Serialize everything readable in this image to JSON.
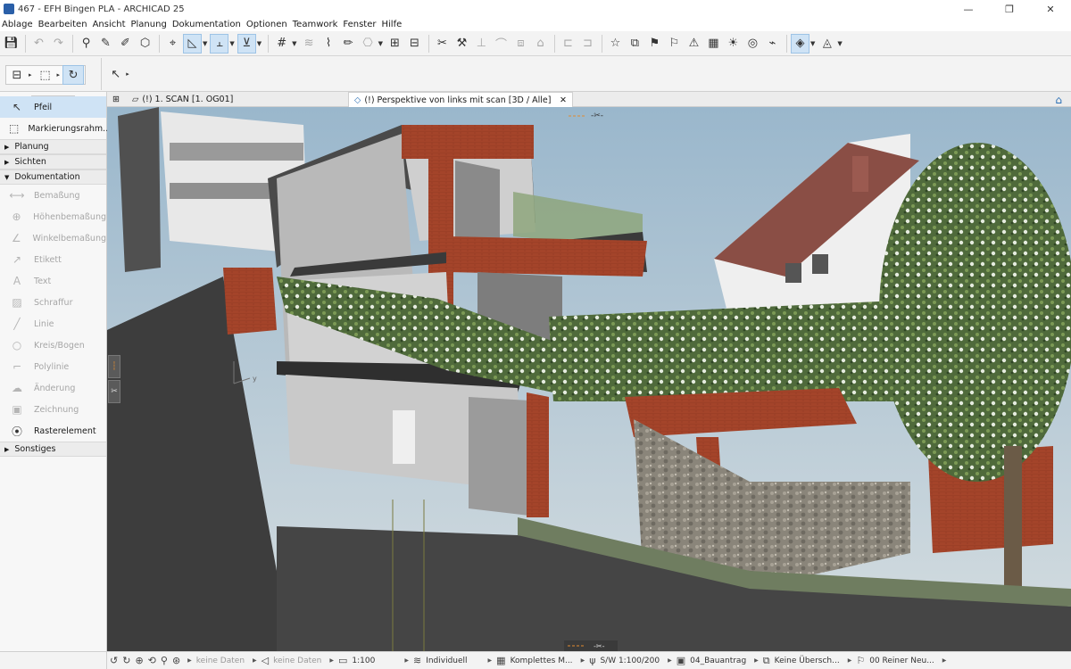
{
  "titlebar": {
    "title": "467 - EFH Bingen PLA - ARCHICAD 25",
    "minimize": "—",
    "maximize": "❐",
    "close": "✕"
  },
  "menu": [
    "Ablage",
    "Bearbeiten",
    "Ansicht",
    "Planung",
    "Dokumentation",
    "Optionen",
    "Teamwork",
    "Fenster",
    "Hilfe"
  ],
  "sidebar": {
    "tools_top": [
      {
        "label": "Pfeil",
        "icon": "arrow-pointer-icon",
        "glyph": "↖"
      },
      {
        "label": "Markierungsrahm...",
        "icon": "marquee-icon",
        "glyph": "⬚"
      }
    ],
    "sections": {
      "planung": "Planung",
      "sichten": "Sichten",
      "dokumentation": "Dokumentation",
      "sonstiges": "Sonstiges"
    },
    "doc_tools": [
      {
        "label": "Bemaßung",
        "icon": "dimension-icon",
        "glyph": "⟷"
      },
      {
        "label": "Höhenbemaßung",
        "icon": "level-dimension-icon",
        "glyph": "⊕"
      },
      {
        "label": "Winkelbemaßung",
        "icon": "angle-dimension-icon",
        "glyph": "∠"
      },
      {
        "label": "Etikett",
        "icon": "label-icon",
        "glyph": "↗"
      },
      {
        "label": "Text",
        "icon": "text-icon",
        "glyph": "A"
      },
      {
        "label": "Schraffur",
        "icon": "fill-icon",
        "glyph": "▨"
      },
      {
        "label": "Linie",
        "icon": "line-icon",
        "glyph": "╱"
      },
      {
        "label": "Kreis/Bogen",
        "icon": "circle-icon",
        "glyph": "○"
      },
      {
        "label": "Polylinie",
        "icon": "polyline-icon",
        "glyph": "⌐"
      },
      {
        "label": "Änderung",
        "icon": "change-icon",
        "glyph": "☁"
      },
      {
        "label": "Zeichnung",
        "icon": "drawing-icon",
        "glyph": "▣"
      },
      {
        "label": "Rasterelement",
        "icon": "grid-element-icon",
        "glyph": "⦿"
      }
    ]
  },
  "tabs": {
    "plan": "(!) 1. SCAN [1. OG01]",
    "perspective": "(!) Perspektive von links mit scan [3D / Alle]",
    "close": "✕"
  },
  "status": {
    "no_data_1": "keine Daten",
    "no_data_2": "keine Daten",
    "scale": "1:100",
    "layer_set": "Individuell",
    "model_view": "Komplettes M...",
    "pen_set": "S/W 1:100/200",
    "renovation": "04_Bauantrag",
    "override": "Keine Übersch...",
    "filter": "00 Reiner Neu..."
  },
  "colors": {
    "accent_selected": "#cfe3f5",
    "brick": "#a4442a",
    "terrain": "#6f7d60",
    "sky": "#8fb0c8"
  }
}
